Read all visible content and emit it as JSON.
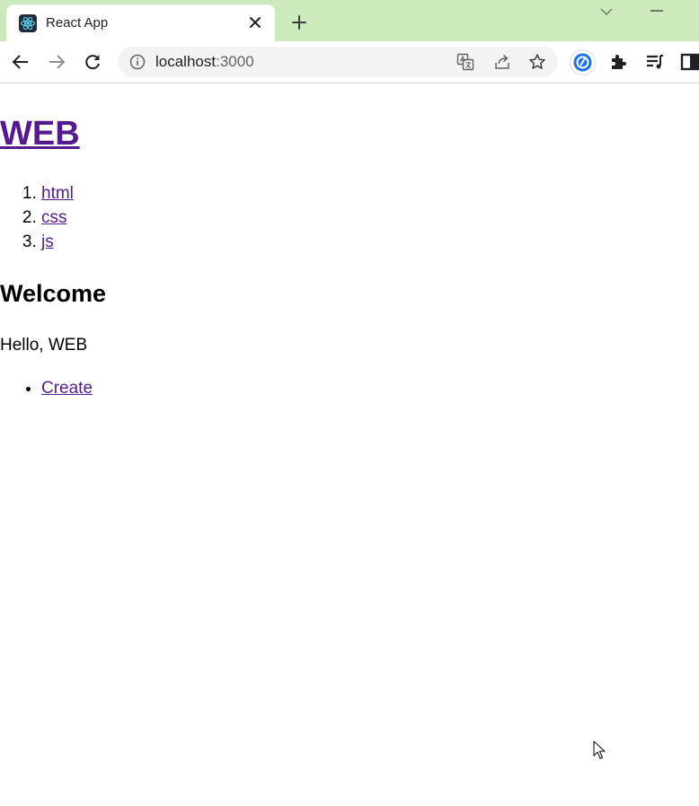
{
  "tab": {
    "title": "React App"
  },
  "address_bar": {
    "host": "localhost",
    "port": ":3000"
  },
  "page": {
    "heading": "WEB",
    "topics": [
      {
        "label": "html"
      },
      {
        "label": "css"
      },
      {
        "label": "js"
      }
    ],
    "article_title": "Welcome",
    "article_body": "Hello, WEB",
    "controls": [
      {
        "label": "Create"
      }
    ]
  },
  "colors": {
    "tabstrip": "#cdeabd",
    "link_visited": "#551a8b",
    "omnibox_bg": "#f1f3f4"
  },
  "icons": {
    "favicon": "react-logo-icon",
    "close": "close-icon",
    "new_tab": "plus-icon",
    "tab_search": "chevron-down-icon",
    "back": "arrow-left-icon",
    "forward": "arrow-right-icon",
    "reload": "reload-icon",
    "info": "info-icon",
    "translate": "translate-icon",
    "share": "share-icon",
    "bookmark": "star-icon",
    "extension_app": "extension-app-icon",
    "extensions": "puzzle-icon",
    "reading_list": "reading-list-icon",
    "side_panel": "side-panel-icon",
    "cursor": "mouse-pointer-icon"
  }
}
